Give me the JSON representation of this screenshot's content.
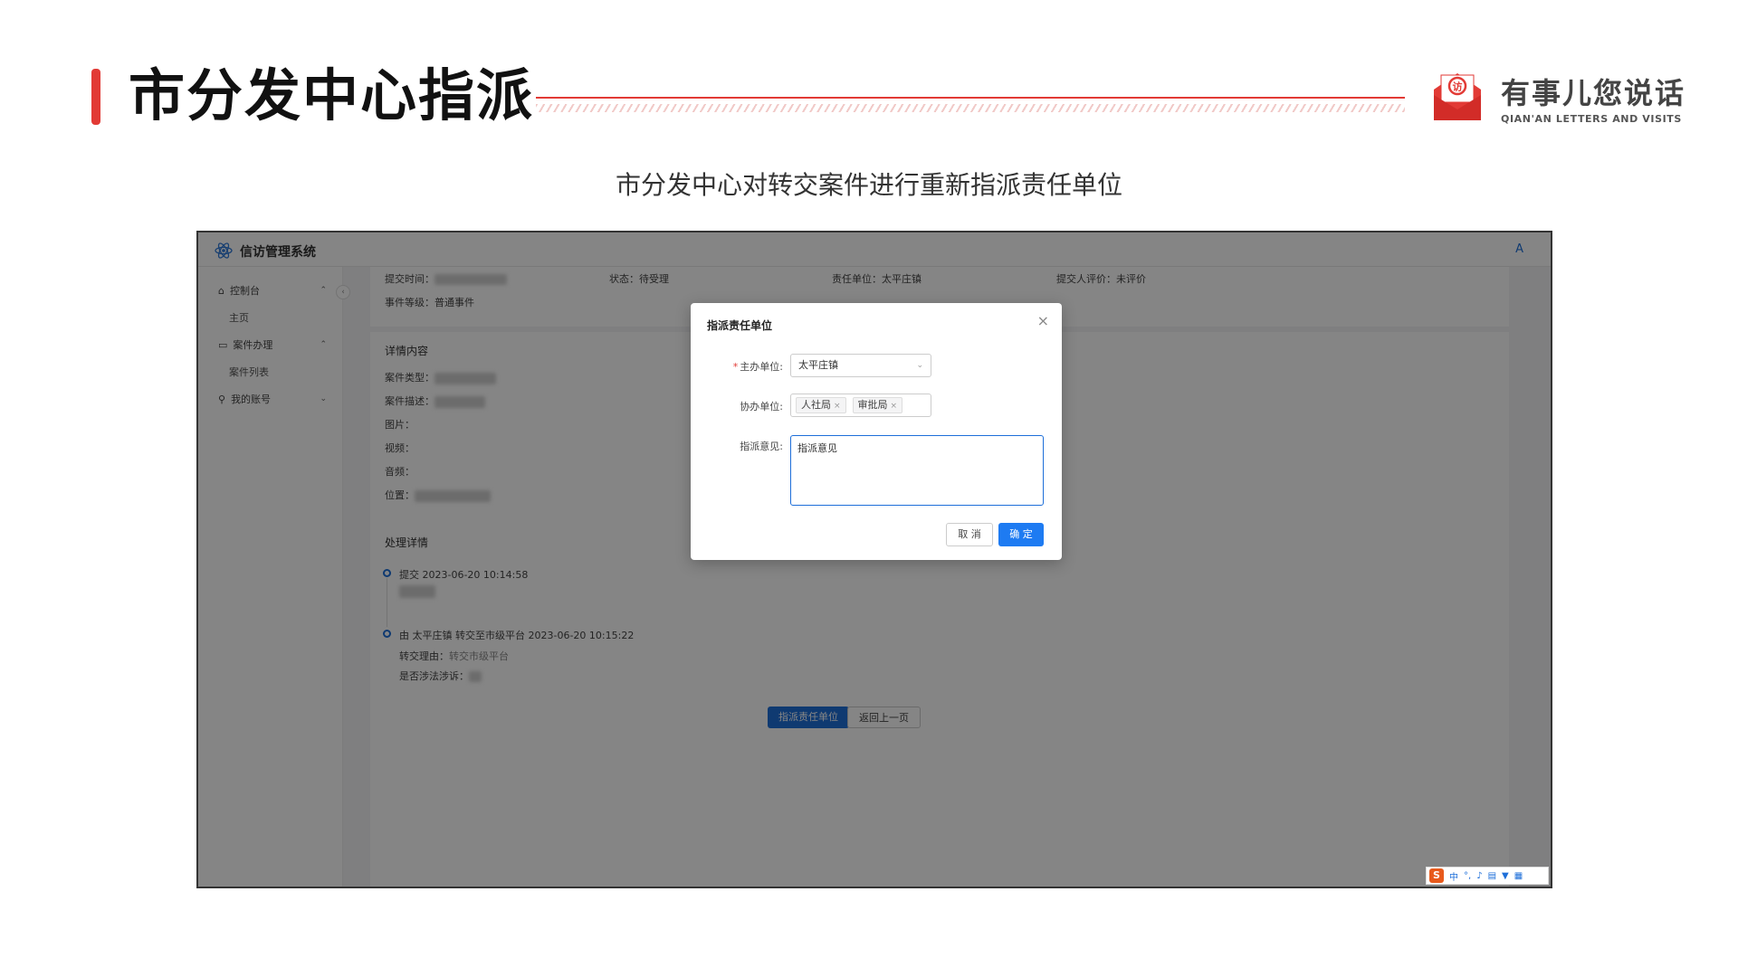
{
  "slide": {
    "title": "市分发中心指派",
    "subtitle": "市分发中心对转交案件进行重新指派责任单位",
    "logo_cn": "有事儿您说话",
    "logo_en": "QIAN'AN LETTERS AND VISITS",
    "logo_glyph": "访"
  },
  "app": {
    "title": "信访管理系统",
    "avatar": "A",
    "sidebar": {
      "items": [
        {
          "label": "控制台",
          "icon": "home-icon",
          "chevron": "⌃"
        },
        {
          "label": "主页"
        },
        {
          "label": "案件办理",
          "icon": "folder-icon",
          "chevron": "⌃"
        },
        {
          "label": "案件列表"
        },
        {
          "label": "我的账号",
          "icon": "user-icon",
          "chevron": "⌄"
        }
      ],
      "collapse": "‹"
    },
    "info": {
      "submit_time_label": "提交时间：",
      "submit_time_value": "2023-06-20 10:14:58",
      "status": "状态：待受理",
      "responsible_unit": "责任单位：太平庄镇",
      "rating": "提交人评价：未评价",
      "level": "事件等级：普通事件"
    },
    "details": {
      "title": "详情内容",
      "fields": [
        "案件类型：",
        "案件描述：",
        "图片：",
        "视频：",
        "音频：",
        "位置："
      ]
    },
    "process": {
      "title": "处理详情",
      "events": [
        {
          "text": "提交 2023-06-20 10:14:58"
        },
        {
          "text": "由 太平庄镇 转交至市级平台 2023-06-20 10:15:22",
          "reason_label": "转交理由：",
          "reason_value": "转交市级平台",
          "litigation_label": "是否涉法涉诉："
        }
      ]
    },
    "buttons": {
      "assign": "指派责任单位",
      "back": "返回上一页"
    }
  },
  "modal": {
    "title": "指派责任单位",
    "close": "×",
    "main_unit_label": "主办单位",
    "main_unit_value": "太平庄镇",
    "assist_unit_label": "协办单位",
    "assist_units": [
      "人社局",
      "审批局"
    ],
    "opinion_label": "指派意见",
    "opinion_value": "指派意见",
    "cancel": "取 消",
    "confirm": "确 定"
  },
  "ime": {
    "logo": "S",
    "mode": "中"
  },
  "colors": {
    "accent_red": "#e23a35",
    "primary_blue": "#1e6fd9"
  }
}
